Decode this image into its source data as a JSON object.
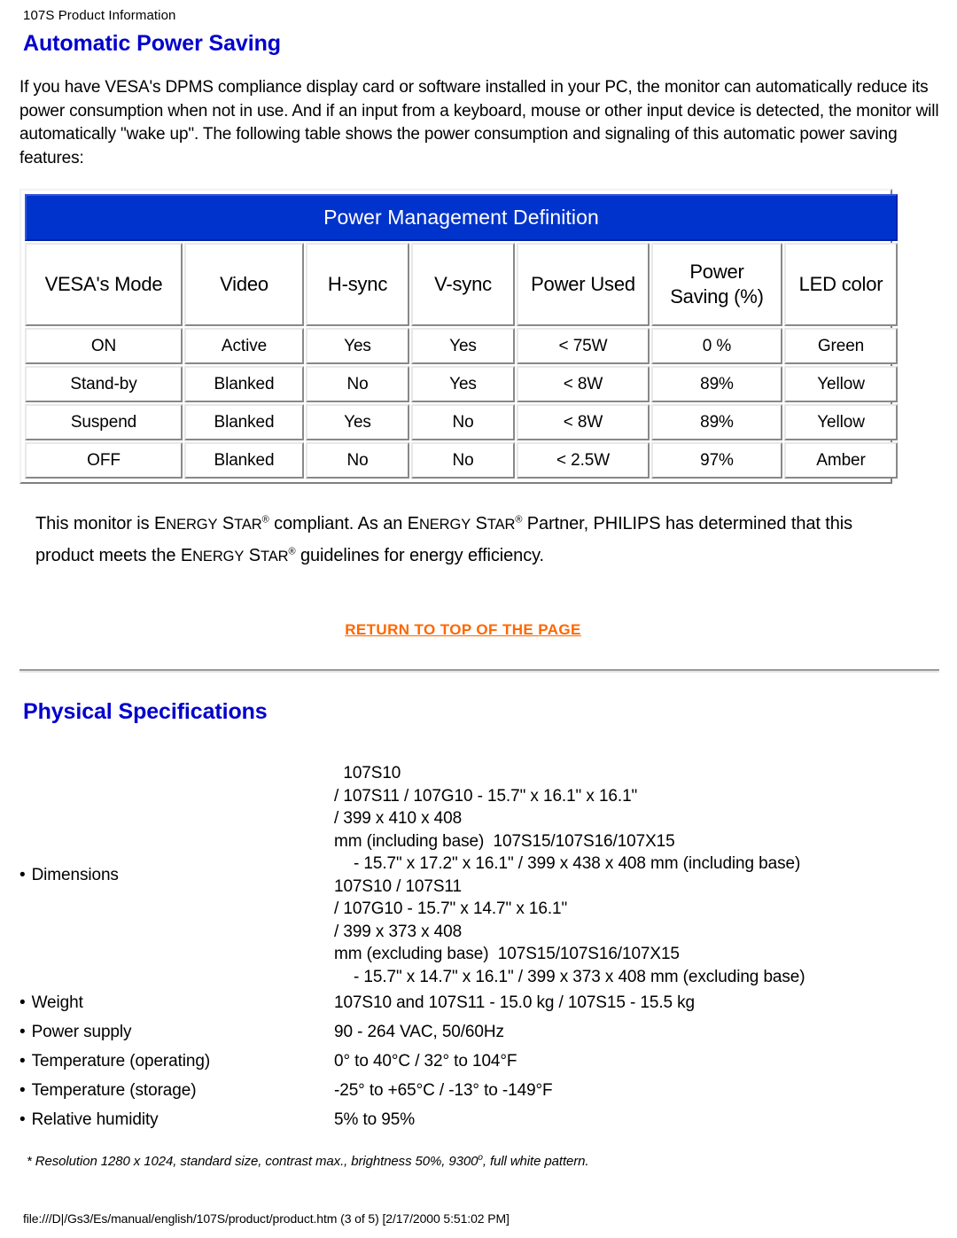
{
  "document": {
    "running_head": "107S Product Information",
    "footer_path": "file:///D|/Gs3/Es/manual/english/107S/product/product.htm (3 of 5) [2/17/2000 5:51:02 PM]"
  },
  "colors": {
    "heading_blue": "#0000CC",
    "table_header_blue": "#0033CC",
    "link_orange": "#FF6600"
  },
  "sections": {
    "power_saving": {
      "title": "Automatic Power Saving",
      "intro": "If you have VESA's DPMS compliance display card or software installed in your PC, the monitor can automatically reduce its power consumption when not in use. And if an input from a keyboard, mouse or other input device is detected, the monitor will automatically \"wake up\". The following table shows the power consumption and signaling of this automatic power saving features:",
      "energy_star": {
        "part1": "This monitor is ",
        "brand1": "ENERGY STAR",
        "part2": " compliant. As an ",
        "brand2": "ENERGY STAR",
        "part3": " Partner, PHILIPS has determined that this product meets the ",
        "brand3": "ENERGY STAR",
        "part4": " guidelines for energy efficiency."
      },
      "return_link": "RETURN TO TOP OF THE PAGE"
    },
    "physical": {
      "title": "Physical Specifications",
      "footnote_pre": "* Resolution 1280 x 1024, standard size, contrast max., brightness 50%, 9300",
      "footnote_deg": "o",
      "footnote_post": ", full white pattern."
    }
  },
  "power_table": {
    "caption": "Power Management Definition",
    "headers": [
      "VESA's Mode",
      "Video",
      "H-sync",
      "V-sync",
      "Power Used",
      "Power Saving (%)",
      "LED color"
    ],
    "header_power_saving_line1": "Power",
    "header_power_saving_line2": "Saving (%)",
    "rows": [
      {
        "mode": "ON",
        "video": "Active",
        "hsync": "Yes",
        "vsync": "Yes",
        "power_used": "< 75W",
        "saving": "0 %",
        "led": "Green"
      },
      {
        "mode": "Stand-by",
        "video": "Blanked",
        "hsync": "No",
        "vsync": "Yes",
        "power_used": "< 8W",
        "saving": "89%",
        "led": "Yellow"
      },
      {
        "mode": "Suspend",
        "video": "Blanked",
        "hsync": "Yes",
        "vsync": "No",
        "power_used": "< 8W",
        "saving": "89%",
        "led": "Yellow"
      },
      {
        "mode": "OFF",
        "video": "Blanked",
        "hsync": "No",
        "vsync": "No",
        "power_used": "< 2.5W",
        "saving": "97%",
        "led": "Amber"
      }
    ]
  },
  "spec_table": {
    "dimensions": {
      "label": "Dimensions",
      "lines": [
        "  107S10",
        "/ 107S11 / 107G10 - 15.7\" x 16.1\" x 16.1\"",
        "/ 399 x 410 x 408",
        "mm (including base)  107S15/107S16/107X15",
        "- 15.7\" x 17.2\" x 16.1\" / 399 x 438 x 408 mm (including base)",
        "107S10 / 107S11",
        "/ 107G10 - 15.7\" x 14.7\" x 16.1\"",
        "/ 399 x 373 x 408",
        "mm (excluding base)  107S15/107S16/107X15",
        "- 15.7\" x 14.7\" x 16.1\" / 399 x 373 x 408 mm (excluding base)"
      ],
      "indented": [
        false,
        false,
        false,
        false,
        true,
        false,
        false,
        false,
        false,
        true
      ]
    },
    "rows": [
      {
        "label": "Weight",
        "value": "107S10 and 107S11 - 15.0 kg / 107S15 - 15.5 kg"
      },
      {
        "label": "Power supply",
        "value": "90 - 264 VAC, 50/60Hz"
      },
      {
        "label": "Temperature (operating)",
        "value": "0° to 40°C / 32° to 104°F"
      },
      {
        "label": "Temperature (storage)",
        "value": "-25° to +65°C / -13° to -149°F"
      },
      {
        "label": "Relative humidity",
        "value": "5% to 95%"
      }
    ]
  }
}
